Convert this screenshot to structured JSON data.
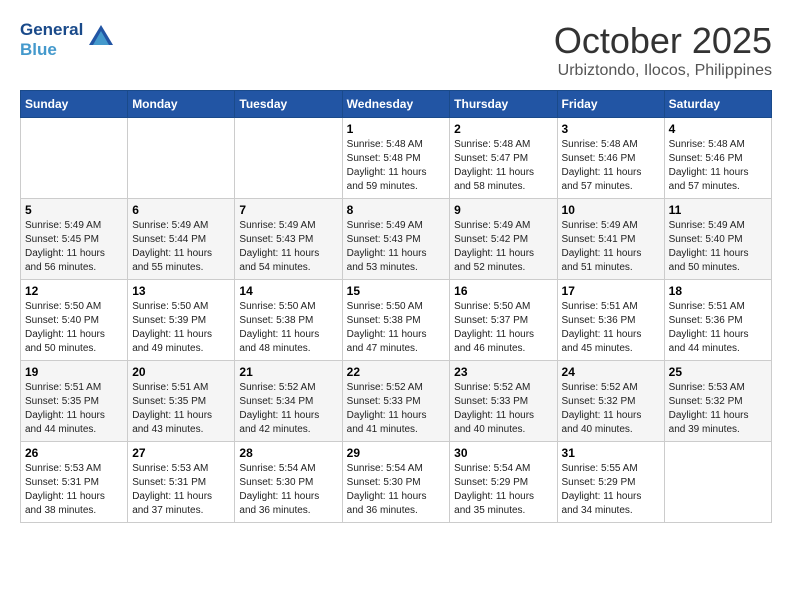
{
  "header": {
    "logo_line1": "General",
    "logo_line2": "Blue",
    "month": "October 2025",
    "location": "Urbiztondo, Ilocos, Philippines"
  },
  "days_of_week": [
    "Sunday",
    "Monday",
    "Tuesday",
    "Wednesday",
    "Thursday",
    "Friday",
    "Saturday"
  ],
  "weeks": [
    [
      {
        "day": "",
        "info": ""
      },
      {
        "day": "",
        "info": ""
      },
      {
        "day": "",
        "info": ""
      },
      {
        "day": "1",
        "info": "Sunrise: 5:48 AM\nSunset: 5:48 PM\nDaylight: 11 hours\nand 59 minutes."
      },
      {
        "day": "2",
        "info": "Sunrise: 5:48 AM\nSunset: 5:47 PM\nDaylight: 11 hours\nand 58 minutes."
      },
      {
        "day": "3",
        "info": "Sunrise: 5:48 AM\nSunset: 5:46 PM\nDaylight: 11 hours\nand 57 minutes."
      },
      {
        "day": "4",
        "info": "Sunrise: 5:48 AM\nSunset: 5:46 PM\nDaylight: 11 hours\nand 57 minutes."
      }
    ],
    [
      {
        "day": "5",
        "info": "Sunrise: 5:49 AM\nSunset: 5:45 PM\nDaylight: 11 hours\nand 56 minutes."
      },
      {
        "day": "6",
        "info": "Sunrise: 5:49 AM\nSunset: 5:44 PM\nDaylight: 11 hours\nand 55 minutes."
      },
      {
        "day": "7",
        "info": "Sunrise: 5:49 AM\nSunset: 5:43 PM\nDaylight: 11 hours\nand 54 minutes."
      },
      {
        "day": "8",
        "info": "Sunrise: 5:49 AM\nSunset: 5:43 PM\nDaylight: 11 hours\nand 53 minutes."
      },
      {
        "day": "9",
        "info": "Sunrise: 5:49 AM\nSunset: 5:42 PM\nDaylight: 11 hours\nand 52 minutes."
      },
      {
        "day": "10",
        "info": "Sunrise: 5:49 AM\nSunset: 5:41 PM\nDaylight: 11 hours\nand 51 minutes."
      },
      {
        "day": "11",
        "info": "Sunrise: 5:49 AM\nSunset: 5:40 PM\nDaylight: 11 hours\nand 50 minutes."
      }
    ],
    [
      {
        "day": "12",
        "info": "Sunrise: 5:50 AM\nSunset: 5:40 PM\nDaylight: 11 hours\nand 50 minutes."
      },
      {
        "day": "13",
        "info": "Sunrise: 5:50 AM\nSunset: 5:39 PM\nDaylight: 11 hours\nand 49 minutes."
      },
      {
        "day": "14",
        "info": "Sunrise: 5:50 AM\nSunset: 5:38 PM\nDaylight: 11 hours\nand 48 minutes."
      },
      {
        "day": "15",
        "info": "Sunrise: 5:50 AM\nSunset: 5:38 PM\nDaylight: 11 hours\nand 47 minutes."
      },
      {
        "day": "16",
        "info": "Sunrise: 5:50 AM\nSunset: 5:37 PM\nDaylight: 11 hours\nand 46 minutes."
      },
      {
        "day": "17",
        "info": "Sunrise: 5:51 AM\nSunset: 5:36 PM\nDaylight: 11 hours\nand 45 minutes."
      },
      {
        "day": "18",
        "info": "Sunrise: 5:51 AM\nSunset: 5:36 PM\nDaylight: 11 hours\nand 44 minutes."
      }
    ],
    [
      {
        "day": "19",
        "info": "Sunrise: 5:51 AM\nSunset: 5:35 PM\nDaylight: 11 hours\nand 44 minutes."
      },
      {
        "day": "20",
        "info": "Sunrise: 5:51 AM\nSunset: 5:35 PM\nDaylight: 11 hours\nand 43 minutes."
      },
      {
        "day": "21",
        "info": "Sunrise: 5:52 AM\nSunset: 5:34 PM\nDaylight: 11 hours\nand 42 minutes."
      },
      {
        "day": "22",
        "info": "Sunrise: 5:52 AM\nSunset: 5:33 PM\nDaylight: 11 hours\nand 41 minutes."
      },
      {
        "day": "23",
        "info": "Sunrise: 5:52 AM\nSunset: 5:33 PM\nDaylight: 11 hours\nand 40 minutes."
      },
      {
        "day": "24",
        "info": "Sunrise: 5:52 AM\nSunset: 5:32 PM\nDaylight: 11 hours\nand 40 minutes."
      },
      {
        "day": "25",
        "info": "Sunrise: 5:53 AM\nSunset: 5:32 PM\nDaylight: 11 hours\nand 39 minutes."
      }
    ],
    [
      {
        "day": "26",
        "info": "Sunrise: 5:53 AM\nSunset: 5:31 PM\nDaylight: 11 hours\nand 38 minutes."
      },
      {
        "day": "27",
        "info": "Sunrise: 5:53 AM\nSunset: 5:31 PM\nDaylight: 11 hours\nand 37 minutes."
      },
      {
        "day": "28",
        "info": "Sunrise: 5:54 AM\nSunset: 5:30 PM\nDaylight: 11 hours\nand 36 minutes."
      },
      {
        "day": "29",
        "info": "Sunrise: 5:54 AM\nSunset: 5:30 PM\nDaylight: 11 hours\nand 36 minutes."
      },
      {
        "day": "30",
        "info": "Sunrise: 5:54 AM\nSunset: 5:29 PM\nDaylight: 11 hours\nand 35 minutes."
      },
      {
        "day": "31",
        "info": "Sunrise: 5:55 AM\nSunset: 5:29 PM\nDaylight: 11 hours\nand 34 minutes."
      },
      {
        "day": "",
        "info": ""
      }
    ]
  ]
}
